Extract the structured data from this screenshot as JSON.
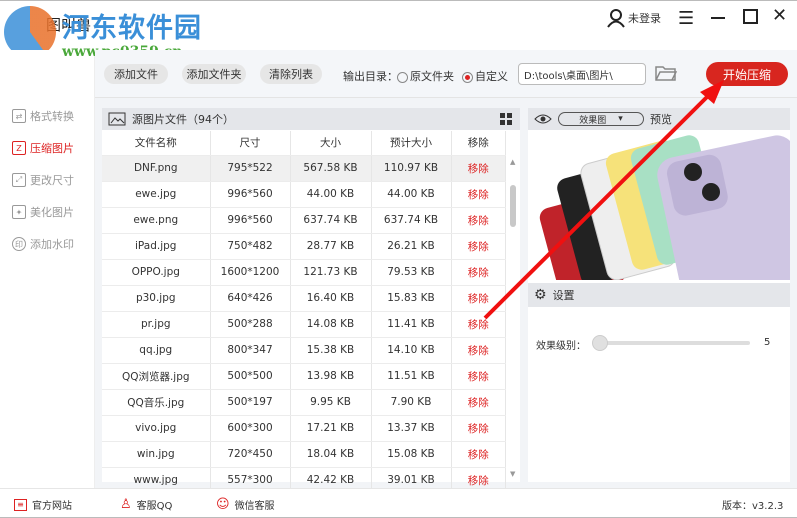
{
  "watermark": {
    "title": "河东软件园",
    "url": "www.pc0359.cn"
  },
  "app": {
    "title": "图叫兽",
    "user": "未登录"
  },
  "sidebar": {
    "items": [
      {
        "label": "格式转换"
      },
      {
        "label": "压缩图片"
      },
      {
        "label": "更改尺寸"
      },
      {
        "label": "美化图片"
      },
      {
        "label": "添加水印"
      }
    ]
  },
  "toolbar": {
    "add_file": "添加文件",
    "add_folder": "添加文件夹",
    "clear_list": "清除列表",
    "output_label": "输出目录：",
    "opt_original": "原文件夹",
    "opt_custom": "自定义",
    "path": "D:\\tools\\桌面\\图片\\",
    "start": "开始压缩"
  },
  "table": {
    "title": "源图片文件（94个）",
    "headers": [
      "文件名称",
      "尺寸",
      "大小",
      "预计大小",
      "移除"
    ],
    "rows": [
      [
        "DNF.png",
        "795*522",
        "567.58 KB",
        "110.97 KB",
        "移除"
      ],
      [
        "ewe.jpg",
        "996*560",
        "44.00 KB",
        "44.00 KB",
        "移除"
      ],
      [
        "ewe.png",
        "996*560",
        "637.74 KB",
        "637.74 KB",
        "移除"
      ],
      [
        "iPad.jpg",
        "750*482",
        "28.77 KB",
        "26.21 KB",
        "移除"
      ],
      [
        "OPPO.jpg",
        "1600*1200",
        "121.73 KB",
        "79.53 KB",
        "移除"
      ],
      [
        "p30.jpg",
        "640*426",
        "16.40 KB",
        "15.83 KB",
        "移除"
      ],
      [
        "pr.jpg",
        "500*288",
        "14.08 KB",
        "11.41 KB",
        "移除"
      ],
      [
        "qq.jpg",
        "800*347",
        "15.38 KB",
        "14.10 KB",
        "移除"
      ],
      [
        "QQ浏览器.jpg",
        "500*500",
        "13.98 KB",
        "11.51 KB",
        "移除"
      ],
      [
        "QQ音乐.jpg",
        "500*197",
        "9.95 KB",
        "7.90 KB",
        "移除"
      ],
      [
        "vivo.jpg",
        "600*300",
        "17.21 KB",
        "13.37 KB",
        "移除"
      ],
      [
        "win.jpg",
        "720*450",
        "18.04 KB",
        "15.08 KB",
        "移除"
      ],
      [
        "www.jpg",
        "557*300",
        "42.42 KB",
        "39.01 KB",
        "移除"
      ]
    ]
  },
  "preview": {
    "mode": "效果图",
    "label": "预览"
  },
  "settings": {
    "title": "设置",
    "level_label": "效果级别：",
    "level": 5
  },
  "footer": {
    "site": "官方网站",
    "qq": "客服QQ",
    "wechat": "微信客服",
    "version": "版本：v3.2.3"
  },
  "colors": {
    "accent": "#d8261f"
  }
}
